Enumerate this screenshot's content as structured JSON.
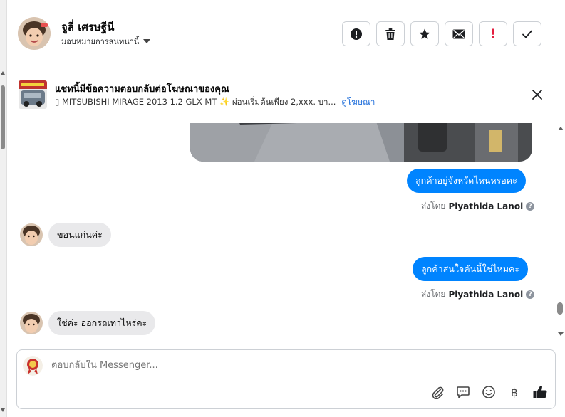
{
  "header": {
    "name": "จูลี่ เศรษฐีนี",
    "assign_label": "มอบหมายการสนทนานี้",
    "actions": [
      {
        "icon": "alert-circle-icon"
      },
      {
        "icon": "trash-icon"
      },
      {
        "icon": "star-icon"
      },
      {
        "icon": "envelope-icon"
      },
      {
        "icon": "exclamation-icon",
        "text": "!"
      },
      {
        "icon": "checkmark-icon"
      }
    ]
  },
  "ad": {
    "title": "แชทนี้มีข้อความตอบกลับต่อโฆษณาของคุณ",
    "subtitle": "▯ MITSUBISHI MIRAGE 2013 1.2 GLX MT ✨ ผ่อนเริ่มต้นเพียง 2,xxx. บา...",
    "link": "ดูโฆษณา"
  },
  "messages": {
    "out1": "ลูกค้าอยู่จังหวัดไหนหรอคะ",
    "sent_prefix": "ส่งโดย",
    "sender": "Piyathida Lanoi",
    "in1": "ขอนแก่นค่ะ",
    "out2": "ลูกค้าสนใจคันนี้ใช่ไหมคะ",
    "in2": "ใช่ค่ะ ออกรถเท่าไหร่คะ"
  },
  "composer": {
    "placeholder": "ตอบกลับใน Messenger...",
    "currency_symbol": "฿"
  },
  "colors": {
    "accent": "#0084ff",
    "link": "#216fdb",
    "incoming_bubble": "#e9e9eb",
    "danger": "#e41e3f"
  }
}
